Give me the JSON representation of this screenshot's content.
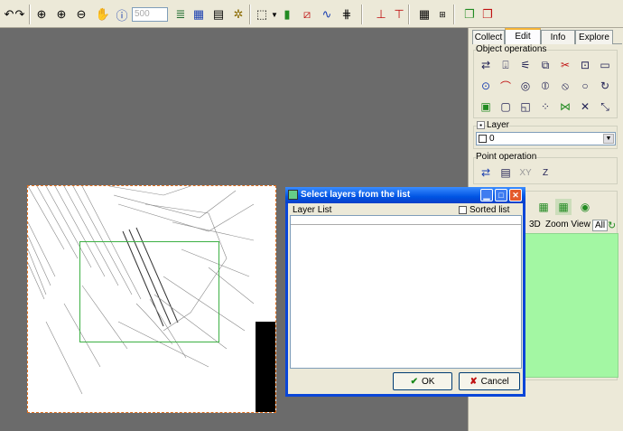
{
  "toolbar": {
    "scale_value": "500"
  },
  "panel": {
    "tabs": [
      "Collect",
      "Edit",
      "Info",
      "Explore"
    ],
    "object_operations_label": "Object operations",
    "layer_label": "Layer",
    "layer_value": "0",
    "point_operation_label": "Point operation",
    "xy_label": "XY",
    "z_label": "Z",
    "view_tabs": [
      "3D",
      "Zoom View",
      "All"
    ]
  },
  "dialog": {
    "title": "Select layers from the list",
    "layer_list_label": "Layer List",
    "sorted_label": "Sorted list",
    "ok_label": "OK",
    "cancel_label": "Cancel"
  },
  "colors": {
    "map_border": "#e07020",
    "selection_rect": "#3cb043",
    "panel_green": "#a3f7a3",
    "title_blue": "#0054e3"
  }
}
